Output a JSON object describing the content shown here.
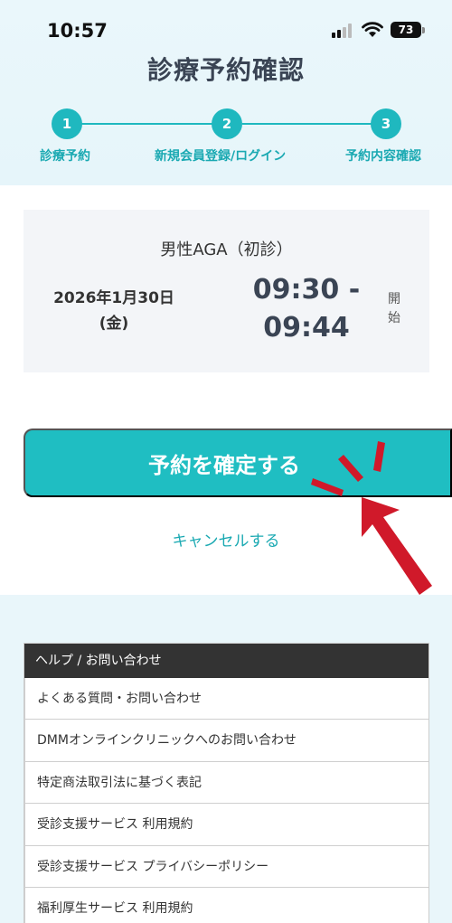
{
  "status_bar": {
    "time": "10:57",
    "battery": "73"
  },
  "header": {
    "title": "診療予約確認"
  },
  "steps": [
    {
      "number": "1",
      "label": "診療予約"
    },
    {
      "number": "2",
      "label": "新規会員登録/ログイン"
    },
    {
      "number": "3",
      "label": "予約内容確認"
    }
  ],
  "reservation": {
    "menu": "男性AGA（初診）",
    "date_line1": "2026年1月30日",
    "date_line2": "(金)",
    "time_line1": "09:30 -",
    "time_line2": "09:44",
    "start_label": "開始"
  },
  "actions": {
    "confirm_label": "予約を確定する",
    "cancel_label": "キャンセルする"
  },
  "help": {
    "header": "ヘルプ / お問い合わせ",
    "items": [
      "よくある質問・お問い合わせ",
      "DMMオンラインクリニックへのお問い合わせ",
      "特定商法取引法に基づく表記",
      "受診支援サービス 利用規約",
      "受診支援サービス プライバシーポリシー",
      "福利厚生サービス 利用規約"
    ]
  },
  "colors": {
    "accent": "#1fbec2",
    "title": "#3a4454",
    "annotation_red": "#d0192a"
  }
}
